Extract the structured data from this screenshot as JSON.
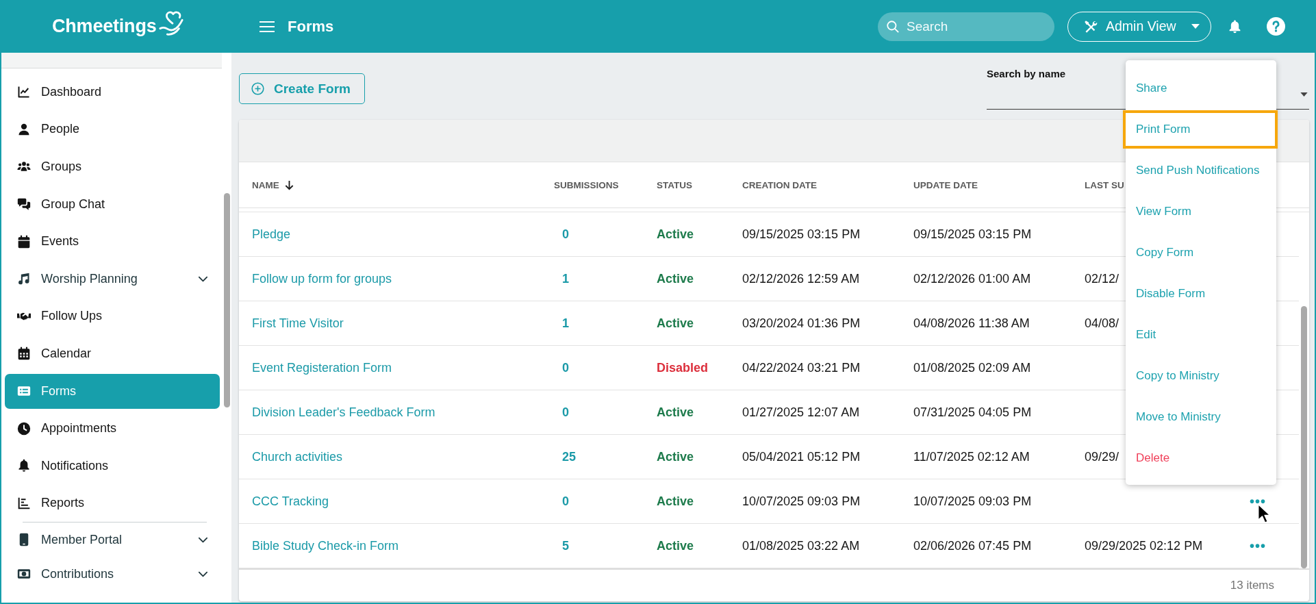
{
  "top_bar": {
    "logo": "Chmeetings",
    "title": "Forms",
    "search": {
      "placeholder": "Search"
    },
    "view_button": "Admin View"
  },
  "sidebar": {
    "items": [
      {
        "label": "Dashboard",
        "kind": "link",
        "selected": false
      },
      {
        "label": "People",
        "kind": "link",
        "selected": false
      },
      {
        "label": "Groups",
        "kind": "link",
        "selected": false
      },
      {
        "label": "Group Chat",
        "kind": "link",
        "selected": false
      },
      {
        "label": "Events",
        "kind": "link",
        "selected": false
      },
      {
        "label": "Worship Planning",
        "kind": "group",
        "expanded": false,
        "selected": false
      },
      {
        "label": "Follow Ups",
        "kind": "link",
        "selected": false
      },
      {
        "label": "Calendar",
        "kind": "link",
        "selected": false
      },
      {
        "label": "Forms",
        "kind": "link",
        "selected": true
      },
      {
        "label": "Appointments",
        "kind": "link",
        "selected": false
      },
      {
        "label": "Notifications",
        "kind": "link",
        "selected": false
      },
      {
        "label": "Reports",
        "kind": "link",
        "selected": false
      }
    ],
    "secondary_items": [
      {
        "label": "Member Portal",
        "kind": "group",
        "expanded": false,
        "selected": false
      },
      {
        "label": "Contributions",
        "kind": "group",
        "expanded": false,
        "selected": false
      }
    ]
  },
  "toolbar": {
    "create_button": "Create Form",
    "name_filter": {
      "label": "Search by name"
    }
  },
  "table": {
    "columns": [
      {
        "label": "NAME",
        "sorted": true
      },
      {
        "label": "SUBMISSIONS",
        "sorted": false
      },
      {
        "label": "STATUS",
        "sorted": false
      },
      {
        "label": "CREATION DATE",
        "sorted": false
      },
      {
        "label": "UPDATE DATE",
        "sorted": false
      },
      {
        "label": "LAST SU",
        "sorted": false
      }
    ],
    "rows": [
      {
        "name": "Pledge",
        "submissions": "0",
        "status": "Active",
        "enabled": true,
        "created": "09/15/2025 03:15 PM",
        "updated": "09/15/2025 03:15 PM"
      },
      {
        "name": "Follow up form for groups",
        "submissions": "1",
        "status": "Active",
        "enabled": true,
        "created": "02/12/2026 12:59 AM",
        "updated": "02/12/2026 01:00 AM",
        "last_submission": "02/12/"
      },
      {
        "name": "First Time Visitor",
        "submissions": "1",
        "status": "Active",
        "enabled": true,
        "created": "03/20/2024 01:36 PM",
        "updated": "04/08/2026 11:38 AM",
        "last_submission": "04/08/"
      },
      {
        "name": "Event Registeration Form",
        "submissions": "0",
        "status": "Disabled",
        "enabled": false,
        "created": "04/22/2024 03:21 PM",
        "updated": "01/08/2025 02:09 AM"
      },
      {
        "name": "Division Leader's Feedback Form",
        "submissions": "0",
        "status": "Active",
        "enabled": true,
        "created": "01/27/2025 12:07 AM",
        "updated": "07/31/2025 04:05 PM"
      },
      {
        "name": "Church activities",
        "submissions": "25",
        "status": "Active",
        "enabled": true,
        "created": "05/04/2021 05:12 PM",
        "updated": "11/07/2025 02:12 AM",
        "last_submission": "09/29/"
      },
      {
        "name": "CCC Tracking",
        "submissions": "0",
        "status": "Active",
        "enabled": true,
        "created": "10/07/2025 09:03 PM",
        "updated": "10/07/2025 09:03 PM",
        "actions": "•••"
      },
      {
        "name": "Bible Study Check-in Form",
        "submissions": "5",
        "status": "Active",
        "enabled": true,
        "created": "01/08/2025 03:22 AM",
        "updated": "02/06/2026 07:45 PM",
        "last_submission": "09/29/2025 02:12 PM",
        "actions": "•••"
      }
    ],
    "footer": "13 items"
  },
  "row_menu": {
    "items": [
      {
        "label": "Share",
        "kind": "action",
        "highlighted": false
      },
      {
        "label": "Print Form",
        "kind": "action",
        "highlighted": true
      },
      {
        "label": "Send Push Notifications",
        "kind": "action",
        "highlighted": false
      },
      {
        "label": "View Form",
        "kind": "action",
        "highlighted": false
      },
      {
        "label": "Copy Form",
        "kind": "action",
        "highlighted": false
      },
      {
        "label": "Disable Form",
        "kind": "action",
        "highlighted": false
      },
      {
        "label": "Edit",
        "kind": "action",
        "highlighted": false
      },
      {
        "label": "Copy to Ministry",
        "kind": "action",
        "highlighted": false
      },
      {
        "label": "Move to Ministry",
        "kind": "action",
        "highlighted": false
      },
      {
        "label": "Delete",
        "kind": "danger",
        "highlighted": false
      }
    ]
  }
}
